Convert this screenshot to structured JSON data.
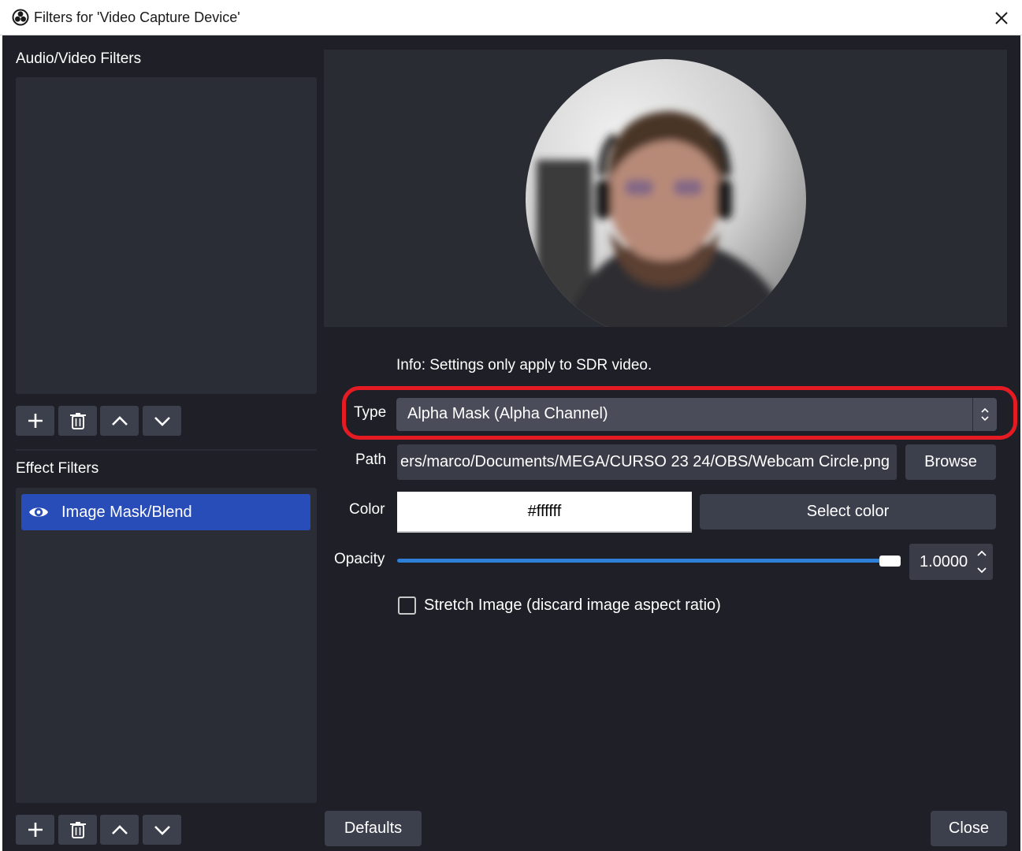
{
  "window": {
    "title": "Filters for 'Video Capture Device'",
    "logo_icon": "obs-logo-icon",
    "close_icon": "close-icon"
  },
  "left": {
    "audio_video_label": "Audio/Video Filters",
    "effect_label": "Effect Filters",
    "toolbar_icons": [
      "plus-icon",
      "trash-icon",
      "chevron-up-icon",
      "chevron-down-icon"
    ],
    "effect_filters": [
      {
        "label": "Image Mask/Blend",
        "icon": "eye-icon",
        "selected": true
      }
    ]
  },
  "properties": {
    "info": "Info: Settings only apply to SDR video.",
    "type_label": "Type",
    "type_value": "Alpha Mask (Alpha Channel)",
    "path_label": "Path",
    "path_value": "ers/marco/Documents/MEGA/CURSO 23 24/OBS/Webcam Circle.png",
    "browse_label": "Browse",
    "color_label": "Color",
    "color_value": "#ffffff",
    "select_color_label": "Select color",
    "opacity_label": "Opacity",
    "opacity_value": "1.0000",
    "opacity_fraction": 1.0,
    "stretch_label": "Stretch Image (discard image aspect ratio)",
    "stretch_checked": false
  },
  "footer": {
    "defaults_label": "Defaults",
    "close_label": "Close"
  },
  "colors": {
    "background": "#1f2027",
    "panel": "#2b2d36",
    "button": "#3c404d",
    "selection": "#284cb8",
    "accent_slider": "#2e7fd8",
    "highlight_outline": "#e51b24"
  }
}
